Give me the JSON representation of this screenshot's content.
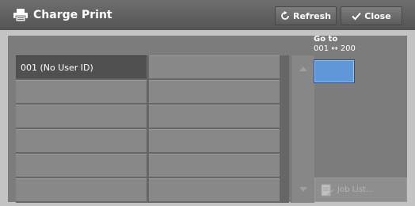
{
  "header": {
    "title": "Charge Print",
    "refresh_label": "Refresh",
    "close_label": "Close"
  },
  "list": {
    "rows": [
      [
        "001  (No User ID)",
        ""
      ],
      [
        "",
        ""
      ],
      [
        "",
        ""
      ],
      [
        "",
        ""
      ],
      [
        "",
        ""
      ],
      [
        "",
        ""
      ]
    ],
    "selected_index": 0
  },
  "goto": {
    "label": "Go to",
    "range": "001 ↔ 200",
    "value": ""
  },
  "job_list": {
    "label": "Job List..."
  },
  "colors": {
    "accent": "#5f97d9",
    "header": "#5e5e5e",
    "selected_row": "#505050"
  },
  "icons": {
    "title": "printer-icon",
    "refresh": "refresh-icon",
    "close": "checkmark-icon",
    "job_list": "document-pen-icon"
  }
}
